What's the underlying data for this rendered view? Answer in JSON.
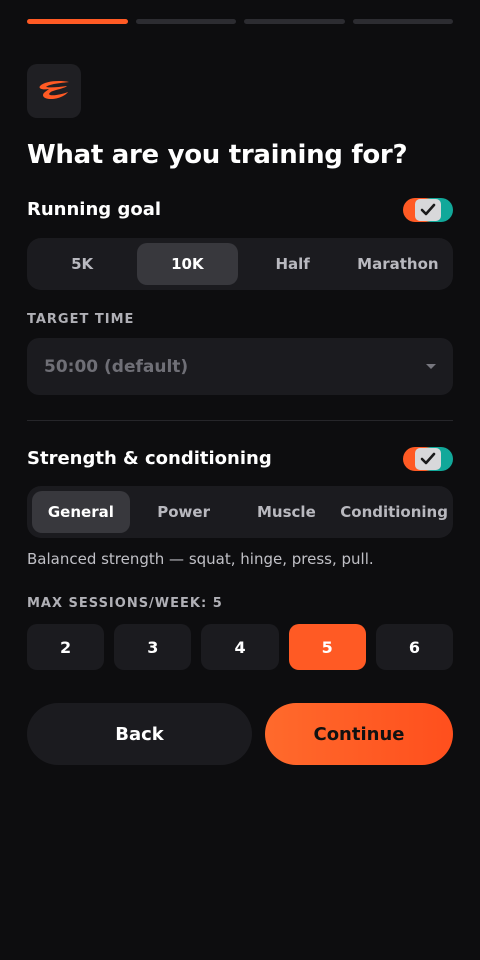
{
  "progress": {
    "total_steps": 4,
    "current_step": 1
  },
  "header": {
    "title": "What are you training for?",
    "logo_icon": "swoosh-logo-icon"
  },
  "running": {
    "label": "Running goal",
    "enabled": true,
    "options": [
      "5K",
      "10K",
      "Half",
      "Marathon"
    ],
    "selected": "10K",
    "target_time_label": "TARGET TIME",
    "target_time_value": "50:00 (default)"
  },
  "strength": {
    "label": "Strength & conditioning",
    "enabled": true,
    "options": [
      "General",
      "Power",
      "Muscle",
      "Conditioning"
    ],
    "selected": "General",
    "description": "Balanced strength — squat, hinge, press, pull.",
    "sessions_label": "MAX SESSIONS/WEEK: 5",
    "sessions_options": [
      "2",
      "3",
      "4",
      "5",
      "6"
    ],
    "sessions_selected": "5"
  },
  "actions": {
    "back_label": "Back",
    "continue_label": "Continue"
  },
  "colors": {
    "accent": "#ff5a24",
    "toggle_on_right": "#11a89a",
    "background": "#0d0d0f",
    "surface": "#1b1b1f"
  }
}
